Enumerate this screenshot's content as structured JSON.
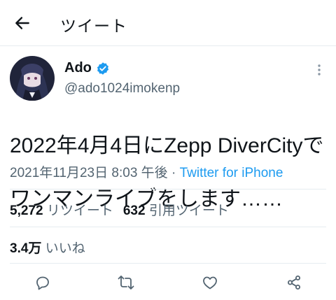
{
  "header": {
    "title": "ツイート",
    "back_icon": "arrow-left-icon"
  },
  "author": {
    "display_name": "Ado",
    "handle": "@ado1024imokenp",
    "verified_color": "#1d9bf0"
  },
  "tweet": {
    "text_line1": "2022年4月4日にZepp DiverCityで",
    "text_line2": "ワンマンライブをします……",
    "timestamp": "2021年11月23日 8:03 午後",
    "separator": " · ",
    "source": "Twitter for iPhone"
  },
  "stats": {
    "retweets_count": "5,272",
    "retweets_label": "リツイート",
    "quotes_count": "632",
    "quotes_label": "引用ツイート",
    "likes_count": "3.4万",
    "likes_label": "いいね"
  },
  "actions": [
    "reply-icon",
    "retweet-icon",
    "like-icon",
    "share-icon"
  ],
  "colors": {
    "accent": "#1d9bf0",
    "secondary_text": "#536471",
    "primary_text": "#0f1419",
    "divider": "#e6ecf0"
  }
}
